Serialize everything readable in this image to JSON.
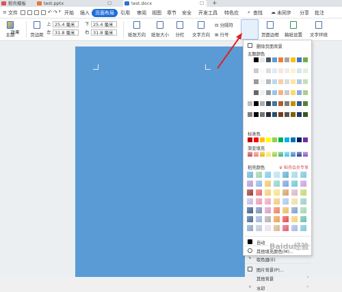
{
  "tabs": [
    {
      "label": "稻壳模板",
      "color": "#d9534f"
    },
    {
      "label": "test.pptx",
      "color": "#e07b39"
    },
    {
      "label": "test.docx",
      "color": "#2b6fd6"
    }
  ],
  "menu": {
    "file": "文件",
    "items": [
      "开始",
      "插入",
      "页面布局",
      "引用",
      "审阅",
      "视图",
      "章节",
      "安全",
      "开发工具",
      "特色应"
    ],
    "active": "页面布局",
    "search": "查找",
    "sync": "未同步",
    "share": "分享",
    "comment": "批注"
  },
  "ribbon": {
    "theme": "主题",
    "effects": "效果",
    "margins": "页边距",
    "top_label": "上",
    "top_value": "25.4 毫米",
    "bottom_label": "下",
    "bottom_value": "25.4 毫米",
    "left_label": "左",
    "left_value": "31.8 毫米",
    "right_label": "右",
    "right_value": "31.8 毫米",
    "orientation": "纸张方向",
    "size": "纸张大小",
    "columns": "分栏",
    "text_direction": "文字方向",
    "breaks": "分隔符",
    "line_numbers": "行号",
    "background": "背景",
    "page_border": "页面边框",
    "paper_settings": "稿纸设置",
    "text_wrap": "文字环绕"
  },
  "dropdown": {
    "remove_bg": "删除页面背景",
    "theme_colors": "主题颜色",
    "standard_colors": "标准色",
    "gradient_fill": "渐变填充",
    "docer_colors": "稻壳颜色",
    "docer_member": "稻壳会员专享",
    "auto": "自动",
    "more_colors": "其他填充颜色(M)...",
    "eyedropper": "取色器(E)",
    "picture_bg": "图片背景(P)...",
    "other_bg": "其他背景",
    "watermark": "水印"
  },
  "colors": {
    "accent": "#1e6fd9",
    "page_background": "#5b9bd5",
    "arrow": "#e02020",
    "theme_row": [
      "#ffffff",
      "#000000",
      "#e7e6e6",
      "#44546a",
      "#5b9bd5",
      "#ed7d31",
      "#a5a5a5",
      "#ffc000",
      "#4472c4",
      "#70ad47"
    ],
    "standard": [
      "#c00000",
      "#ff0000",
      "#ffc000",
      "#ffff00",
      "#92d050",
      "#00b050",
      "#00b0f0",
      "#0070c0",
      "#002060",
      "#7030a0"
    ],
    "gradient": [
      "#c0504d",
      "#f08080",
      "#e6b800",
      "#ffe066",
      "#9acd32",
      "#3cb371",
      "#48c0e8",
      "#3a7fd0",
      "#1f3f8f",
      "#8b4fb8"
    ]
  },
  "watermark_text": "Baidu经验"
}
